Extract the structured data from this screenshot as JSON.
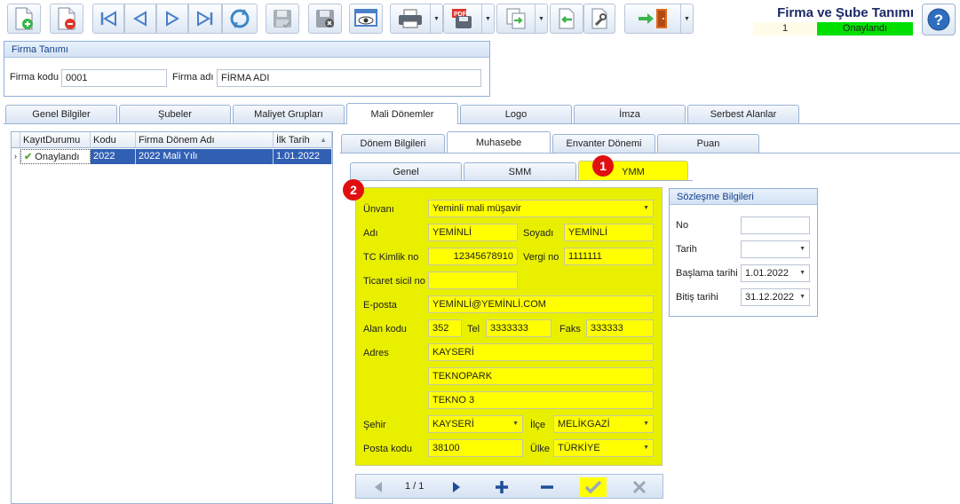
{
  "window": {
    "title": "Firma ve Şube Tanımı",
    "record_no": "1",
    "status": "Onaylandı"
  },
  "colors": {
    "status_green": "#00e000",
    "highlight_yellow": "#ffff00",
    "marker_red": "#e01010",
    "selection_blue": "#3160b3"
  },
  "toolbar": {
    "icons": [
      "new-document-icon",
      "delete-document-icon",
      "first-record-icon",
      "previous-record-icon",
      "next-record-icon",
      "last-record-icon",
      "refresh-icon",
      "save-icon",
      "cancel-save-icon",
      "preview-icon",
      "print-icon",
      "pdf-export-icon",
      "copy-icon",
      "import-icon",
      "tools-icon",
      "exit-icon",
      "help-icon"
    ]
  },
  "firma_tanimi": {
    "title": "Firma Tanımı",
    "code_label": "Firma kodu",
    "code_value": "0001",
    "name_label": "Firma adı",
    "name_value": "FİRMA ADI"
  },
  "main_tabs": [
    "Genel Bilgiler",
    "Şubeler",
    "Maliyet Grupları",
    "Mali Dönemler",
    "Logo",
    "İmza",
    "Serbest Alanlar"
  ],
  "grid": {
    "columns": [
      "KayıtDurumu",
      "Kodu",
      "Firma Dönem Adı",
      "İlk Tarih"
    ],
    "rows": [
      {
        "status": "Onaylandı",
        "code": "2022",
        "name": "2022 Mali Yılı",
        "date": "1.01.2022"
      }
    ]
  },
  "sub_tabs": [
    "Dönem Bilgileri",
    "Muhasebe",
    "Envanter Dönemi",
    "Puan"
  ],
  "inner_tabs": [
    "Genel",
    "SMM",
    "YMM"
  ],
  "markers": [
    "1",
    "2"
  ],
  "ymm": {
    "unvan_label": "Ünvanı",
    "unvan_value": "Yeminli mali müşavir",
    "adi_label": "Adı",
    "adi_value": "YEMİNLİ",
    "soyadi_label": "Soyadı",
    "soyadi_value": "YEMİNLİ",
    "tc_label": "TC Kimlik no",
    "tc_value": "12345678910",
    "vergi_label": "Vergi no",
    "vergi_value": "1111111",
    "ticaret_label": "Ticaret sicil no",
    "ticaret_value": "",
    "eposta_label": "E-posta",
    "eposta_value": "YEMİNLİ@YEMİNLİ.COM",
    "alan_label": "Alan kodu",
    "alan_value": "352",
    "tel_label": "Tel",
    "tel_value": "3333333",
    "faks_label": "Faks",
    "faks_value": "333333",
    "adres_label": "Adres",
    "adres1": "KAYSERİ",
    "adres2": "TEKNOPARK",
    "adres3": "TEKNO 3",
    "sehir_label": "Şehir",
    "sehir_value": "KAYSERİ",
    "ilce_label": "İlçe",
    "ilce_value": "MELİKGAZİ",
    "posta_label": "Posta kodu",
    "posta_value": "38100",
    "ulke_label": "Ülke",
    "ulke_value": "TÜRKİYE"
  },
  "sozlesme": {
    "title": "Sözleşme Bilgileri",
    "no_label": "No",
    "no_value": "",
    "tarih_label": "Tarih",
    "tarih_value": "",
    "baslama_label": "Başlama tarihi",
    "baslama_value": "1.01.2022",
    "bitis_label": "Bitiş tarihi",
    "bitis_value": "31.12.2022"
  },
  "navigator": {
    "position": "1 / 1"
  }
}
